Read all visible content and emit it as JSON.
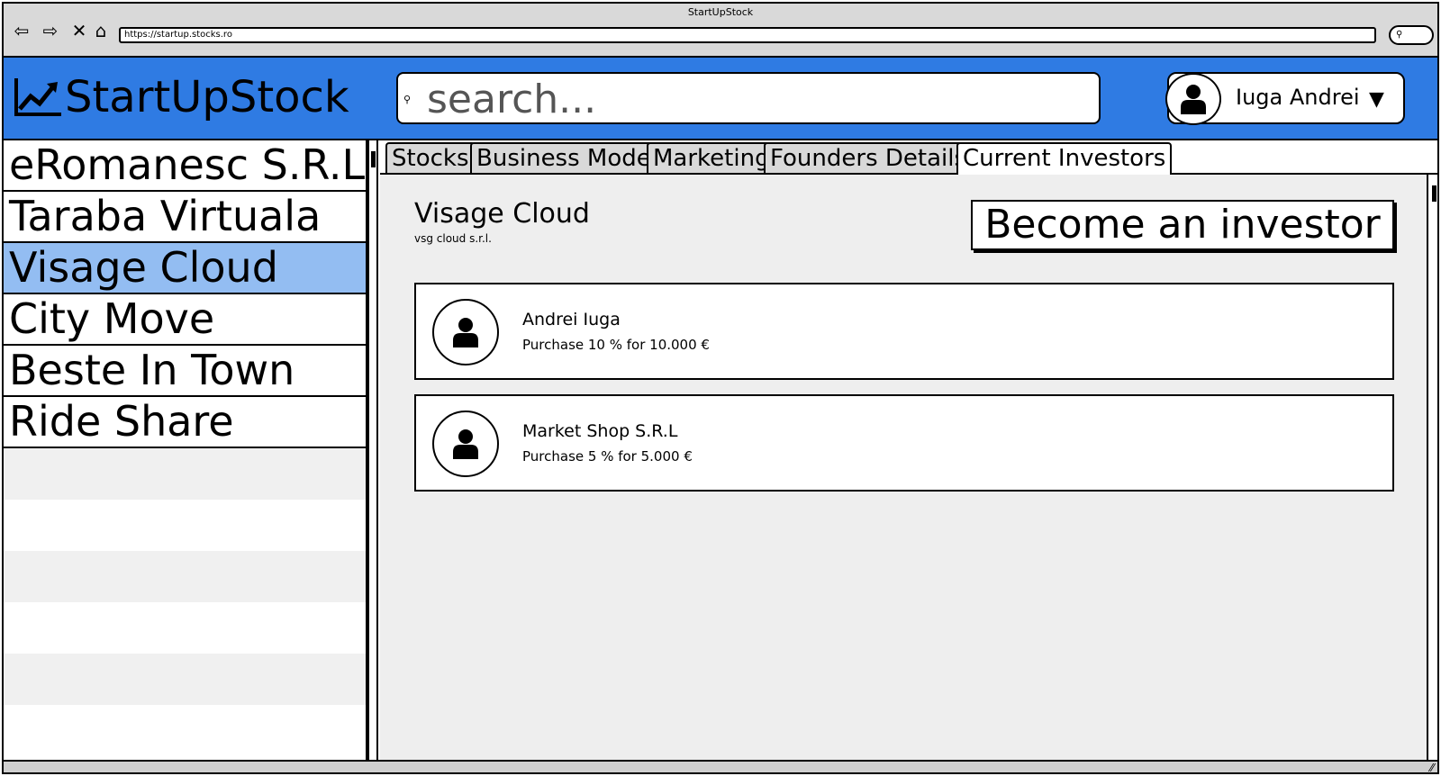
{
  "browser": {
    "window_title": "StartUpStock",
    "url": "https://startup.stocks.ro",
    "nav_icons": [
      "arrow-left-icon",
      "arrow-right-icon",
      "close-icon",
      "home-icon"
    ]
  },
  "header": {
    "logo_text": "StartUpStock",
    "search_placeholder": "search...",
    "user_name": "Iuga Andrei",
    "colors": {
      "header_bg": "#2f7be3",
      "selected_bg": "#93bdf2"
    }
  },
  "sidebar": {
    "items": [
      {
        "label": "eRomanesc S.R.L"
      },
      {
        "label": "Taraba Virtuala"
      },
      {
        "label": "Visage Cloud",
        "selected": true
      },
      {
        "label": "City Move"
      },
      {
        "label": "Beste In Town"
      },
      {
        "label": "Ride Share"
      }
    ]
  },
  "tabs": [
    {
      "label": "Stocks"
    },
    {
      "label": "Business Model"
    },
    {
      "label": "Marketing"
    },
    {
      "label": "Founders Details"
    },
    {
      "label": "Current Investors",
      "active": true
    }
  ],
  "main": {
    "company_name": "Visage Cloud",
    "company_legal_name": "vsg cloud s.r.l.",
    "invest_button": "Become an investor",
    "investors": [
      {
        "name": "Andrei Iuga",
        "detail": "Purchase 10 % for 10.000 €"
      },
      {
        "name": "Market Shop S.R.L",
        "detail": "Purchase 5 % for 5.000 €"
      }
    ]
  }
}
